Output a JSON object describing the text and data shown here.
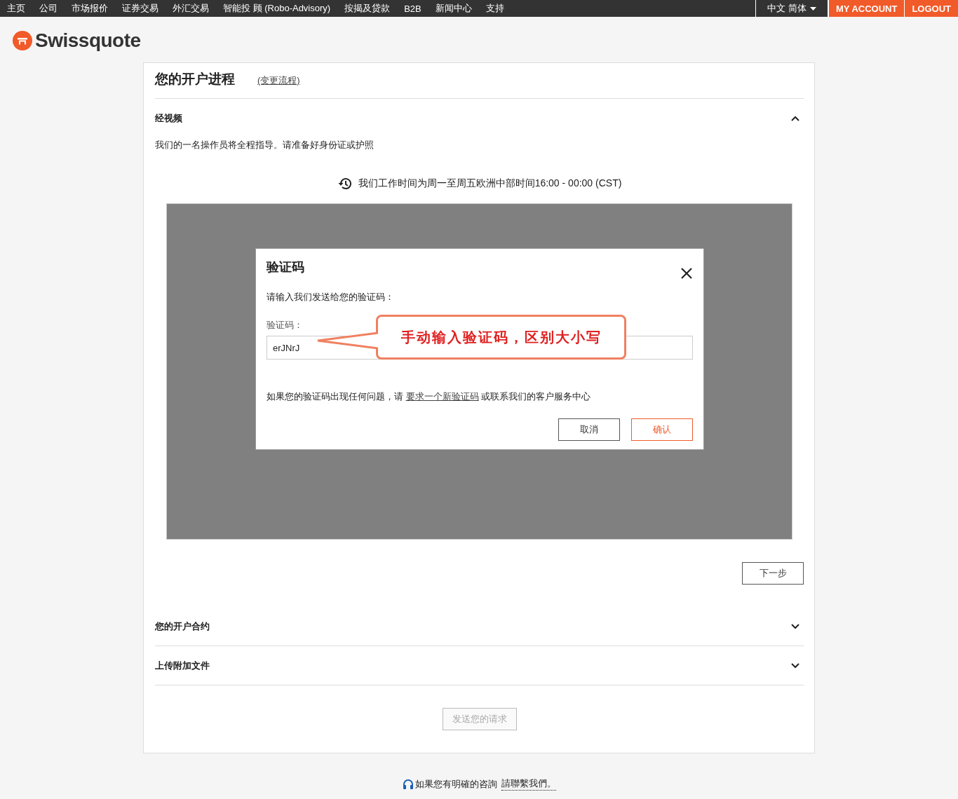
{
  "top_nav": {
    "items": [
      {
        "label": "主页"
      },
      {
        "label": "公司"
      },
      {
        "label": "市场报价"
      },
      {
        "label": "证券交易"
      },
      {
        "label": "外汇交易"
      },
      {
        "label": "智能投 顾 (Robo-Advisory)"
      },
      {
        "label": "按揭及贷款"
      },
      {
        "label": "B2B"
      },
      {
        "label": "新闻中心"
      },
      {
        "label": "支持"
      }
    ],
    "language": "中文 简体",
    "account_buttons": [
      "MY ACCOUNT",
      "LOGOUT"
    ]
  },
  "logo": {
    "text": "Swissquote"
  },
  "progress": {
    "title": "您的开户进程",
    "change_link": "(变更流程)"
  },
  "sections": [
    {
      "title": "经视频",
      "expanded": true
    },
    {
      "title": "您的开户合约",
      "expanded": false
    },
    {
      "title": "上传附加文件",
      "expanded": false
    }
  ],
  "video_step": {
    "description": "我们的一名操作员将全程指导。请准备好身份证或护照",
    "hours": "我们工作时间为周一至周五欧洲中部时间16:00 - 00:00 (CST)",
    "next_button": "下一步"
  },
  "dialog": {
    "title": "验证码",
    "prompt": "请输入我们发送给您的验证码：",
    "field_label": "验证码：",
    "field_value": "erJNrJ",
    "help_before": "如果您的验证码出现任何问题，请",
    "help_link": "要求一个新验证码",
    "help_after": "或联系我们的客户服务中心",
    "cancel": "取消",
    "confirm": "确认"
  },
  "annotation": {
    "text": "手动输入验证码，区别大小写"
  },
  "send_button": {
    "label": "发送您的请求",
    "disabled": true
  },
  "footer": {
    "text": "如果您有明確的咨詢",
    "link": "請聯繫我們。"
  }
}
